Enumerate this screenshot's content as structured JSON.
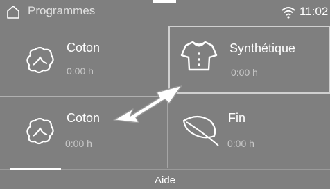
{
  "statusbar": {
    "title": "Programmes",
    "time": "11:02",
    "icons": {
      "home": "home-icon",
      "wifi": "wifi-icon"
    }
  },
  "programs": [
    {
      "name": "Coton",
      "duration": "0:00 h",
      "icon": "cotton-icon",
      "selected": false
    },
    {
      "name": "Synthétique",
      "duration": "0:00 h",
      "icon": "shirt-icon",
      "selected": true
    },
    {
      "name": "Coton",
      "duration": "0:00 h",
      "icon": "cotton-icon",
      "selected": false
    },
    {
      "name": "Fin",
      "duration": "0:00 h",
      "icon": "feather-icon",
      "selected": false
    }
  ],
  "footer": {
    "help_label": "Aide"
  },
  "colors": {
    "background": "#7f7f7f",
    "text": "#ffffff",
    "muted": "#c8c8c8",
    "border": "#d0d0d0"
  },
  "overlay": {
    "icon": "swap-arrow-icon"
  }
}
